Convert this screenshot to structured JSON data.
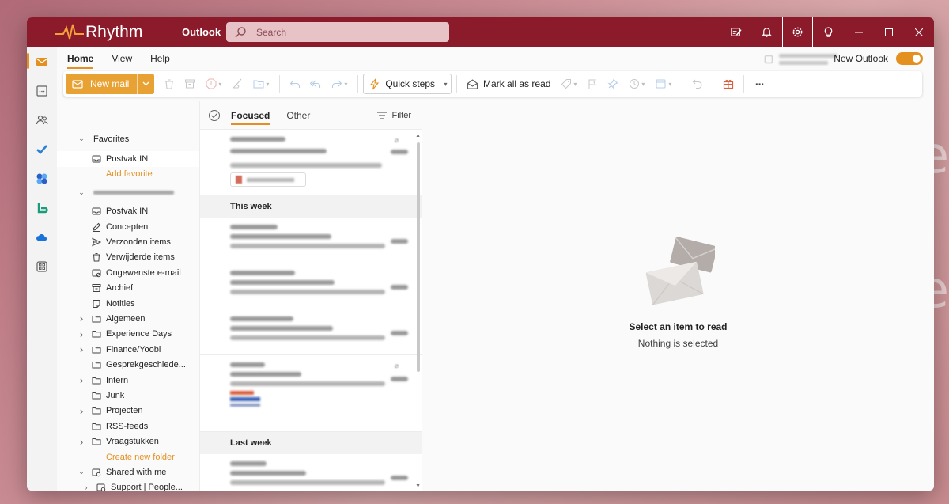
{
  "app": {
    "logo_text": "Rhythm",
    "name": "Outlook",
    "search_placeholder": "Search"
  },
  "ribbon": {
    "tabs": [
      {
        "label": "Home",
        "active": true
      },
      {
        "label": "View",
        "active": false
      },
      {
        "label": "Help",
        "active": false
      }
    ],
    "new_outlook_label": "New Outlook",
    "new_outlook_enabled": true,
    "new_mail_label": "New mail",
    "quick_steps_label": "Quick steps",
    "mark_all_read_label": "Mark all as read",
    "more_label": "···"
  },
  "titlebar_icons": [
    "notes-icon",
    "bell-icon",
    "gear-icon",
    "lightbulb-icon"
  ],
  "rail_icons": [
    "mail-icon",
    "calendar-icon",
    "people-icon",
    "todo-icon",
    "org-icon",
    "bookings-icon",
    "onedrive-icon",
    "apps-icon"
  ],
  "folders": {
    "favorites_label": "Favorites",
    "favorites": [
      {
        "label": "Postvak IN",
        "icon": "inbox-icon"
      }
    ],
    "add_favorite": "Add favorite",
    "mailbox_items": [
      {
        "label": "Postvak IN",
        "icon": "inbox-icon",
        "chevron": false
      },
      {
        "label": "Concepten",
        "icon": "pencil-icon",
        "chevron": false
      },
      {
        "label": "Verzonden items",
        "icon": "send-icon",
        "chevron": false
      },
      {
        "label": "Verwijderde items",
        "icon": "trash-icon",
        "chevron": false
      },
      {
        "label": "Ongewenste e-mail",
        "icon": "junk-icon",
        "chevron": false
      },
      {
        "label": "Archief",
        "icon": "archive-icon",
        "chevron": false
      },
      {
        "label": "Notities",
        "icon": "note-icon",
        "chevron": false
      },
      {
        "label": "Algemeen",
        "icon": "folder-icon",
        "chevron": true
      },
      {
        "label": "Experience Days",
        "icon": "folder-icon",
        "chevron": true
      },
      {
        "label": "Finance/Yoobi",
        "icon": "folder-icon",
        "chevron": true
      },
      {
        "label": "Gesprekgeschiede...",
        "icon": "folder-icon",
        "chevron": false
      },
      {
        "label": "Intern",
        "icon": "folder-icon",
        "chevron": true
      },
      {
        "label": "Junk",
        "icon": "folder-icon",
        "chevron": false
      },
      {
        "label": "Projecten",
        "icon": "folder-icon",
        "chevron": true
      },
      {
        "label": "RSS-feeds",
        "icon": "folder-icon",
        "chevron": false
      },
      {
        "label": "Vraagstukken",
        "icon": "folder-icon",
        "chevron": true
      }
    ],
    "create_new_folder": "Create new folder",
    "shared_label": "Shared with me",
    "shared_child": "Support | People..."
  },
  "message_list": {
    "tabs": [
      {
        "label": "Focused",
        "active": true
      },
      {
        "label": "Other",
        "active": false
      }
    ],
    "filter_label": "Filter",
    "groups": [
      "This week",
      "Last week"
    ]
  },
  "reading_pane": {
    "title": "Select an item to read",
    "subtitle": "Nothing is selected"
  },
  "colors": {
    "titlebar": "#8b1a2b",
    "accent": "#e39021",
    "new_mail_button": "#e8a234"
  }
}
